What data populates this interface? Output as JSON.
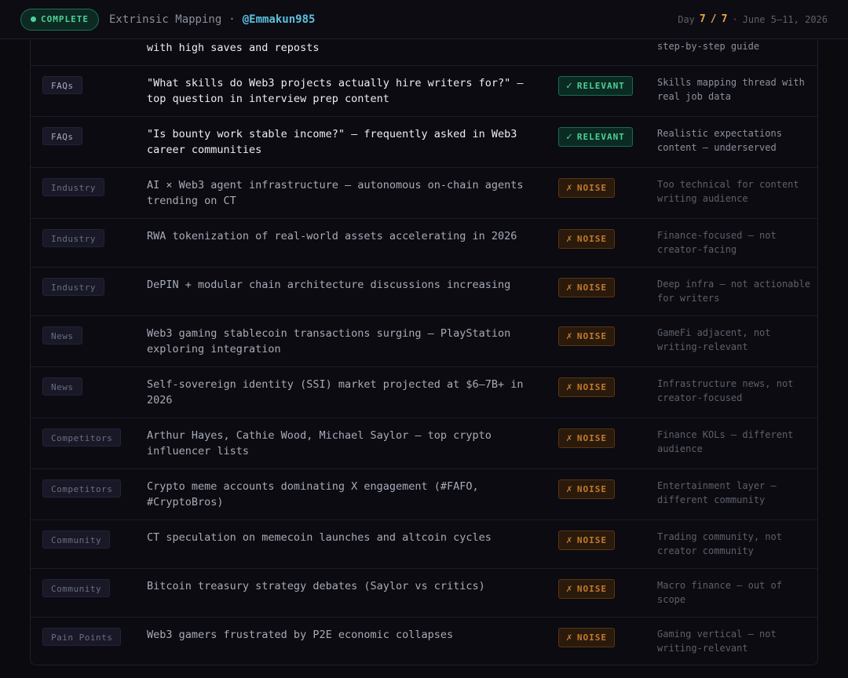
{
  "header": {
    "status": "COMPLETE",
    "title": "Extrinsic Mapping",
    "separator": "·",
    "handle": "@Emmakun985",
    "day_label": "Day",
    "day_current": "7",
    "day_slash": "/",
    "day_total": "7",
    "date_sep": "·",
    "date_range": "June 5–11, 2026"
  },
  "colors": {
    "relevant": "#4ad19a",
    "noise": "#c47a2c",
    "handle": "#5bc0de",
    "day": "#f0a04b"
  },
  "partial_row": {
    "signal": "with high saves and reposts",
    "note": "step-by-step guide"
  },
  "rows": [
    {
      "category": "FAQs",
      "signal": "\"What skills do Web3 projects actually hire writers for?\" — top question in interview prep content",
      "status": "RELEVANT",
      "mark": "✓",
      "note": "Skills mapping thread with real job data"
    },
    {
      "category": "FAQs",
      "signal": "\"Is bounty work stable income?\" — frequently asked in Web3 career communities",
      "status": "RELEVANT",
      "mark": "✓",
      "note": "Realistic expectations content — underserved"
    },
    {
      "category": "Industry",
      "signal": "AI × Web3 agent infrastructure — autonomous on-chain agents trending on CT",
      "status": "NOISE",
      "mark": "✗",
      "note": "Too technical for content writing audience"
    },
    {
      "category": "Industry",
      "signal": "RWA tokenization of real-world assets accelerating in 2026",
      "status": "NOISE",
      "mark": "✗",
      "note": "Finance-focused — not creator-facing"
    },
    {
      "category": "Industry",
      "signal": "DePIN + modular chain architecture discussions increasing",
      "status": "NOISE",
      "mark": "✗",
      "note": "Deep infra — not actionable for writers"
    },
    {
      "category": "News",
      "signal": "Web3 gaming stablecoin transactions surging — PlayStation exploring integration",
      "status": "NOISE",
      "mark": "✗",
      "note": "GameFi adjacent, not writing-relevant"
    },
    {
      "category": "News",
      "signal": "Self-sovereign identity (SSI) market projected at $6–7B+ in 2026",
      "status": "NOISE",
      "mark": "✗",
      "note": "Infrastructure news, not creator-focused"
    },
    {
      "category": "Competitors",
      "signal": "Arthur Hayes, Cathie Wood, Michael Saylor — top crypto influencer lists",
      "status": "NOISE",
      "mark": "✗",
      "note": "Finance KOLs — different audience"
    },
    {
      "category": "Competitors",
      "signal": "Crypto meme accounts dominating X engagement (#FAFO, #CryptoBros)",
      "status": "NOISE",
      "mark": "✗",
      "note": "Entertainment layer — different community"
    },
    {
      "category": "Community",
      "signal": "CT speculation on memecoin launches and altcoin cycles",
      "status": "NOISE",
      "mark": "✗",
      "note": "Trading community, not creator community"
    },
    {
      "category": "Community",
      "signal": "Bitcoin treasury strategy debates (Saylor vs critics)",
      "status": "NOISE",
      "mark": "✗",
      "note": "Macro finance — out of scope"
    },
    {
      "category": "Pain Points",
      "signal": "Web3 gamers frustrated by P2E economic collapses",
      "status": "NOISE",
      "mark": "✗",
      "note": "Gaming vertical — not writing-relevant"
    }
  ]
}
